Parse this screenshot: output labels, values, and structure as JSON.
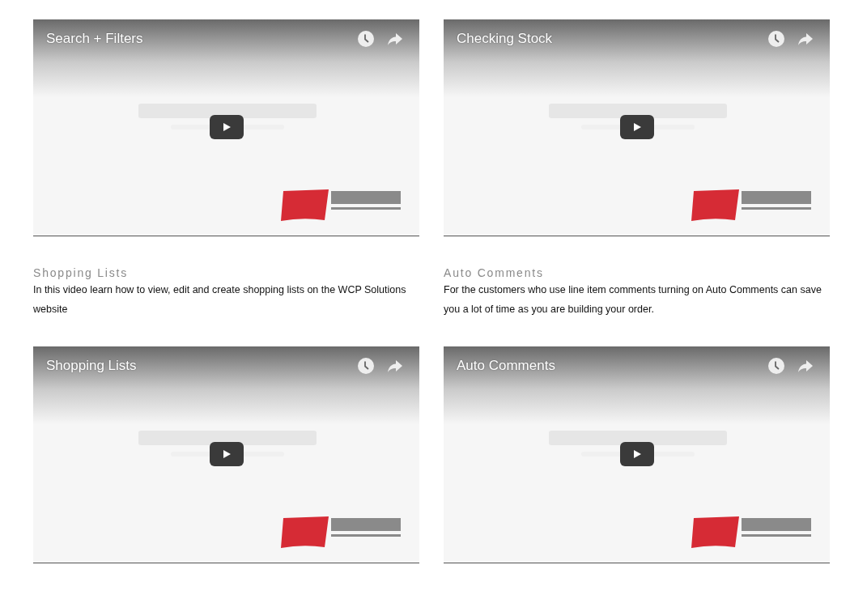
{
  "cells": [
    {
      "kind": "video",
      "title": "Search + Filters"
    },
    {
      "kind": "video",
      "title": "Checking Stock"
    },
    {
      "kind": "caption",
      "heading": "Shopping Lists",
      "description": "In this video learn how to view, edit and create shopping lists on the WCP Solutions website"
    },
    {
      "kind": "caption",
      "heading": "Auto Comments",
      "description": "For the customers who use line item comments turning on Auto Comments  can save you a lot of time as you are building your order."
    },
    {
      "kind": "video",
      "title": "Shopping Lists"
    },
    {
      "kind": "video",
      "title": "Auto Comments"
    }
  ]
}
